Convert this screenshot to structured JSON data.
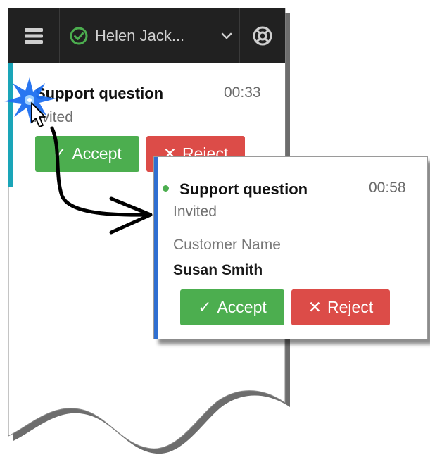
{
  "toolbar": {
    "menu_icon": "hamburger-menu-icon",
    "user_name": "Helen Jack...",
    "status_icon": "ready-status-check-icon",
    "status_color": "#4cae4f",
    "dropdown_icon": "chevron-down-icon",
    "support_icon": "lifebuoy-support-icon"
  },
  "background_card": {
    "title": "Support question",
    "timer": "00:33",
    "state": "Invited",
    "accept_label": "Accept",
    "reject_label": "Reject",
    "accent_color": "#1aa5b8"
  },
  "popup_card": {
    "title": "Support question",
    "timer": "00:58",
    "state": "Invited",
    "field_label": "Customer Name",
    "field_value": "Susan Smith",
    "accept_label": "Accept",
    "reject_label": "Reject",
    "accent_color": "#2f6fd1"
  },
  "colors": {
    "toolbar_bg": "#212121",
    "accept": "#4cae4f",
    "reject": "#dc4c48"
  },
  "annotations": {
    "click_icon": "click-burst-icon",
    "arrow_icon": "curved-arrow-icon"
  }
}
